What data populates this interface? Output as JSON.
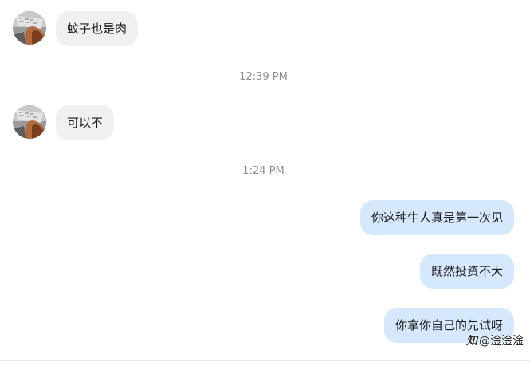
{
  "messages": [
    {
      "side": "incoming",
      "text": "蚊子也是肉"
    },
    {
      "type": "timestamp",
      "text": "12:39 PM"
    },
    {
      "side": "incoming",
      "text": "可以不"
    },
    {
      "type": "timestamp",
      "text": "1:24 PM"
    },
    {
      "side": "outgoing",
      "text": "你这种牛人真是第一次见"
    },
    {
      "side": "outgoing",
      "text": "既然投资不大"
    },
    {
      "side": "outgoing",
      "text": "你拿你自己的先试呀"
    }
  ],
  "watermark": {
    "logo": "知",
    "text": "@淦淦淦"
  },
  "colors": {
    "incoming_bubble": "#f0f0f0",
    "outgoing_bubble": "#d6e9fc",
    "timestamp_text": "#8e8e8e"
  }
}
